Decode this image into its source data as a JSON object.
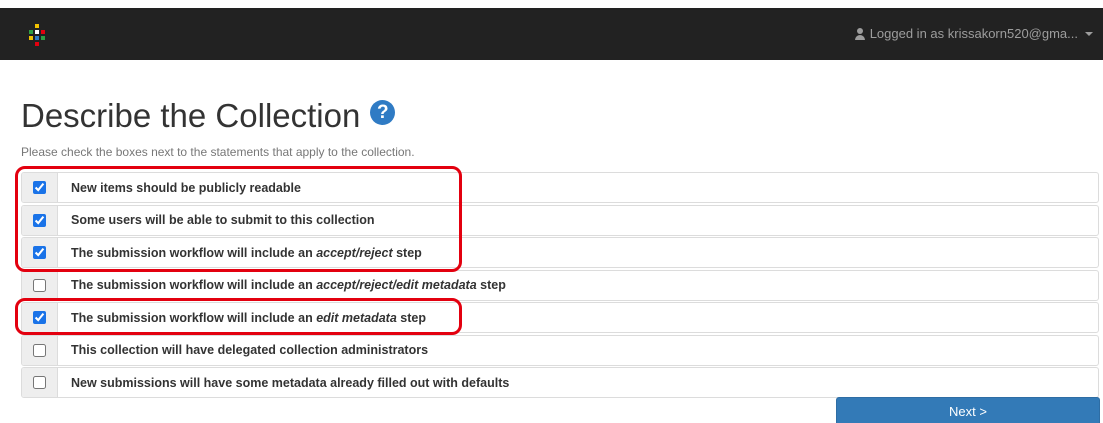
{
  "navbar": {
    "user_label": "Logged in as krissakorn520@gma...",
    "logo_colors": [
      "#f3c300",
      "#2f9e44",
      "#ffffff",
      "#e3000f",
      "#2f7bc4"
    ]
  },
  "page": {
    "title": "Describe the Collection",
    "help_glyph": "?",
    "instructions": "Please check the boxes next to the statements that apply to the collection."
  },
  "options": [
    {
      "pre": "New items should be publicly readable",
      "em": "",
      "post": "",
      "checked": true
    },
    {
      "pre": "Some users will be able to submit to this collection",
      "em": "",
      "post": "",
      "checked": true
    },
    {
      "pre": "The submission workflow will include an ",
      "em": "accept/reject",
      "post": " step",
      "checked": true
    },
    {
      "pre": "The submission workflow will include an ",
      "em": "accept/reject/edit metadata",
      "post": " step",
      "checked": false
    },
    {
      "pre": "The submission workflow will include an ",
      "em": "edit metadata",
      "post": " step",
      "checked": true
    },
    {
      "pre": "This collection will have delegated collection administrators",
      "em": "",
      "post": "",
      "checked": false
    },
    {
      "pre": "New submissions will have some metadata already filled out with defaults",
      "em": "",
      "post": "",
      "checked": false
    }
  ],
  "next_button_label": "Next >",
  "colors": {
    "navbar_bg": "#222222",
    "primary": "#337ab7",
    "highlight": "#e3000f"
  }
}
